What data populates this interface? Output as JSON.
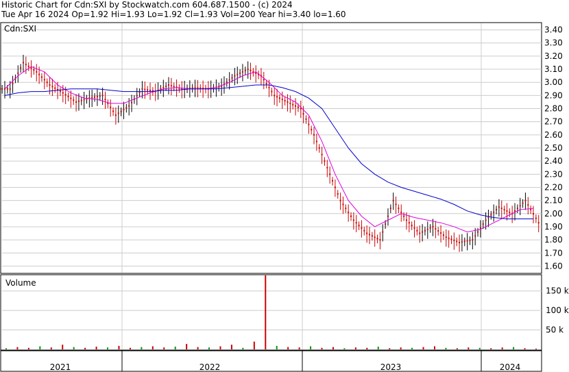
{
  "header": {
    "line1": "Historic Chart for Cdn:SXI by Stockwatch.com 604.687.1500 - (c) 2024",
    "line2": "Tue Apr 16 2024   Op=1.92   Hi=1.93   Lo=1.92   Cl=1.93   Vol=200   Year hi=3.40   lo=1.60"
  },
  "colors": {
    "price_up": "#000000",
    "price_down": "#cc0000",
    "ma_short": "#dd00dd",
    "ma_long": "#0000cc",
    "vol_up": "#009900",
    "vol_down": "#cc0000",
    "grid": "#cccccc"
  },
  "chart_data": [
    {
      "type": "line",
      "title": "Cdn:SXI",
      "ylim": [
        1.55,
        3.45
      ],
      "yticks": [
        "3.40",
        "3.30",
        "3.20",
        "3.10",
        "3.00",
        "2.90",
        "2.80",
        "2.70",
        "2.60",
        "2.50",
        "2.40",
        "2.30",
        "2.20",
        "2.10",
        "2.00",
        "1.90",
        "1.80",
        "1.70",
        "1.60"
      ],
      "x_periods": [
        "2021",
        "2022",
        "2023",
        "2024"
      ],
      "x": [
        "2020-12",
        "2021-01",
        "2021-02",
        "2021-03",
        "2021-04",
        "2021-05",
        "2021-06",
        "2021-07",
        "2021-08",
        "2021-09",
        "2021-10",
        "2021-11",
        "2021-12",
        "2022-01",
        "2022-02",
        "2022-03",
        "2022-04",
        "2022-05",
        "2022-06",
        "2022-07",
        "2022-08",
        "2022-09",
        "2022-10",
        "2022-11",
        "2022-12",
        "2023-01",
        "2023-02",
        "2023-03",
        "2023-04",
        "2023-05",
        "2023-06",
        "2023-07",
        "2023-08",
        "2023-09",
        "2023-10",
        "2023-11",
        "2023-12",
        "2024-01",
        "2024-02",
        "2024-03",
        "2024-04"
      ],
      "series": [
        {
          "values": [
            2.95,
            3.15,
            3.08,
            2.98,
            2.92,
            2.85,
            2.88,
            2.9,
            2.75,
            2.82,
            2.95,
            2.93,
            2.98,
            2.95,
            2.96,
            2.95,
            2.97,
            3.05,
            3.1,
            3.05,
            2.9,
            2.85,
            2.8,
            2.6,
            2.35,
            2.1,
            1.95,
            1.85,
            1.8,
            2.1,
            1.95,
            1.85,
            1.9,
            1.82,
            1.78,
            1.8,
            1.95,
            2.05,
            2.0,
            2.1,
            1.93
          ]
        },
        {
          "values": [
            2.95,
            3.05,
            3.12,
            3.08,
            2.98,
            2.92,
            2.88,
            2.87,
            2.84,
            2.84,
            2.88,
            2.92,
            2.95,
            2.96,
            2.95,
            2.95,
            2.96,
            3.0,
            3.05,
            3.08,
            3.0,
            2.9,
            2.85,
            2.75,
            2.55,
            2.3,
            2.1,
            1.98,
            1.9,
            1.95,
            2.0,
            1.97,
            1.95,
            1.93,
            1.9,
            1.86,
            1.88,
            1.93,
            1.98,
            2.03,
            2.04
          ]
        },
        {
          "values": [
            2.9,
            2.92,
            2.93,
            2.93,
            2.94,
            2.95,
            2.95,
            2.95,
            2.94,
            2.93,
            2.93,
            2.93,
            2.94,
            2.94,
            2.95,
            2.95,
            2.95,
            2.96,
            2.97,
            2.98,
            2.98,
            2.96,
            2.93,
            2.88,
            2.8,
            2.65,
            2.5,
            2.38,
            2.3,
            2.24,
            2.2,
            2.17,
            2.14,
            2.11,
            2.07,
            2.02,
            1.99,
            1.97,
            1.96,
            1.96,
            1.96
          ]
        }
      ]
    },
    {
      "type": "bar",
      "title": "Volume",
      "ylim": [
        0,
        190
      ],
      "yticks": [
        "150 k",
        "100 k",
        "50 k"
      ],
      "x": [
        "2021",
        "2022",
        "2023",
        "2024"
      ],
      "values": [
        3,
        6,
        4,
        8,
        5,
        12,
        6,
        4,
        7,
        5,
        9,
        4,
        6,
        8,
        5,
        7,
        14,
        6,
        5,
        8,
        12,
        4,
        20,
        190,
        9,
        6,
        5,
        8,
        4,
        6,
        3,
        5,
        4,
        7,
        3,
        5,
        4,
        6,
        8,
        4,
        3,
        5,
        4,
        3,
        5,
        6,
        3,
        2
      ]
    }
  ]
}
